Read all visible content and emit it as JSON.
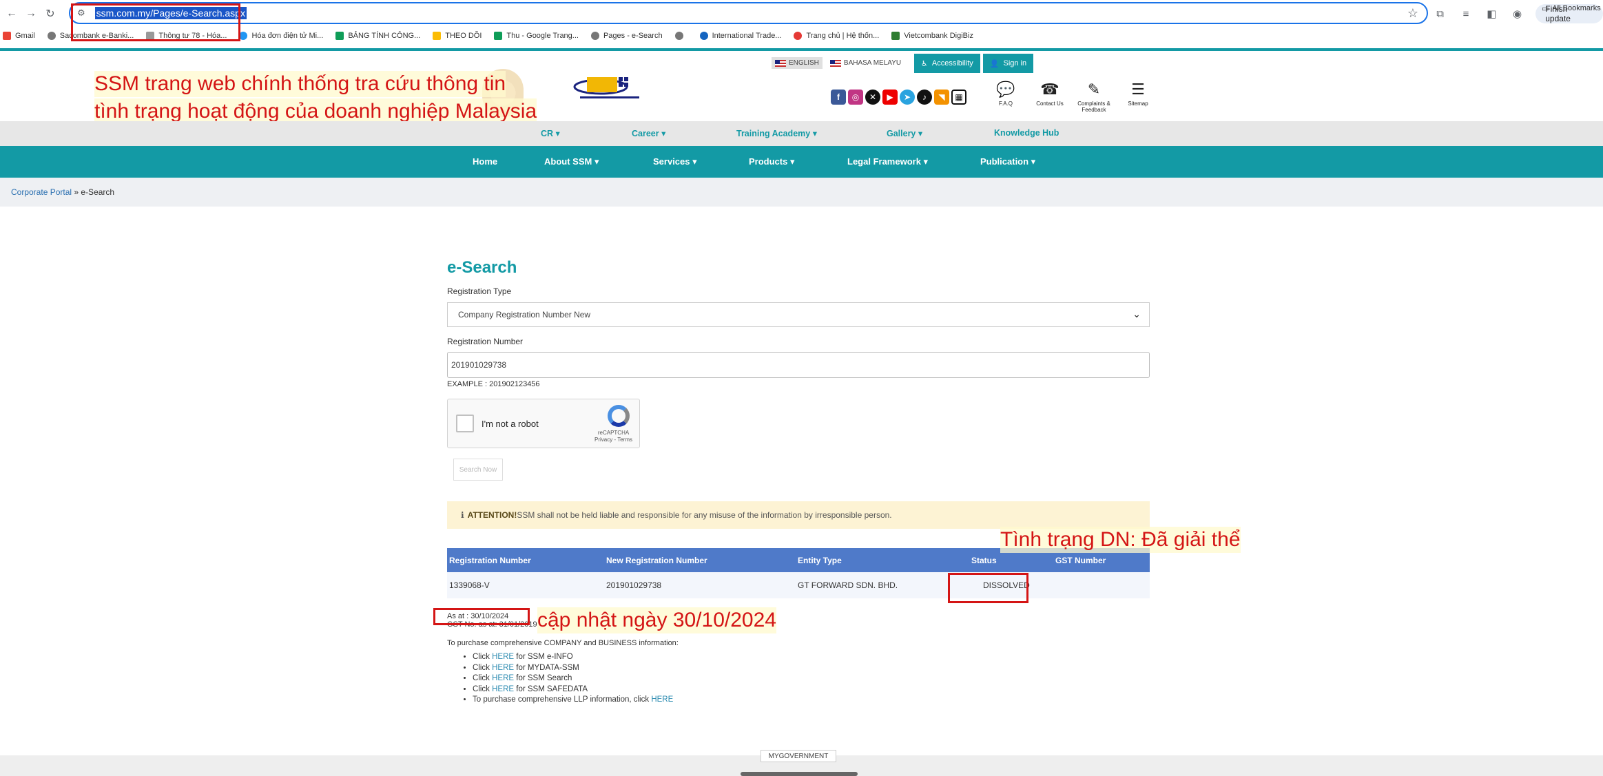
{
  "browser": {
    "url": "ssm.com.my/Pages/e-Search.aspx",
    "finish_update": "Finish update",
    "bookmarks": [
      "Gmail",
      "Sacombank e-Banki...",
      "Thông tư 78 - Hóa...",
      "Hóa đơn điện tử Mi...",
      "BẢNG TÍNH CÔNG...",
      "THEO DÕI",
      "Thu - Google Trang...",
      "Pages - e-Search",
      "",
      "International Trade...",
      "Trang chủ | Hệ thốn...",
      "Vietcombank DigiBiz"
    ],
    "all_bookmarks": "All Bookmarks"
  },
  "header": {
    "lang_en": "ENGLISH",
    "lang_ms": "BAHASA MELAYU",
    "accessibility": "Accessibility",
    "sign_in": "Sign in",
    "quick_links": [
      "F.A.Q",
      "Contact Us",
      "Complaints & Feedback",
      "Sitemap"
    ]
  },
  "annotations": {
    "title_line1": "SSM trang web chính thống tra cứu thông tin",
    "title_line2": "tình trạng hoạt động của doanh nghiệp Malaysia",
    "status_note": "Tình trạng DN: Đã giải thể",
    "date_note": "cập nhật ngày 30/10/2024"
  },
  "subnav": [
    "CR",
    "Career",
    "Training Academy",
    "Gallery",
    "Knowledge Hub"
  ],
  "mainnav": [
    "Home",
    "About SSM",
    "Services",
    "Products",
    "Legal Framework",
    "Publication"
  ],
  "breadcrumb": {
    "home": "Corporate Portal",
    "current": "e-Search"
  },
  "form": {
    "title": "e-Search",
    "reg_type_label": "Registration Type",
    "reg_type_value": "Company Registration Number New",
    "reg_number_label": "Registration Number",
    "reg_number_value": "201901029738",
    "example": "EXAMPLE : 201902123456",
    "captcha_text": "I'm not a robot",
    "captcha_brand": "reCAPTCHA",
    "captcha_terms": "Privacy - Terms",
    "search_button": "Search Now"
  },
  "attention": {
    "label": "ATTENTION!",
    "text": " SSM shall not be held liable and responsible for any misuse of the information by irresponsible person."
  },
  "results": {
    "headers": [
      "Registration Number",
      "New Registration Number",
      "Entity Type",
      "Status",
      "GST Number"
    ],
    "row": [
      "1339068-V",
      "201901029738",
      "GT FORWARD SDN. BHD.",
      "DISSOLVED",
      ""
    ]
  },
  "as_at": "As at : 30/10/2024",
  "gst_as_at": "GST No. as at: 31/01/2019",
  "purchase_intro": "To purchase comprehensive COMPANY and BUSINESS information:",
  "purchase_links": [
    {
      "pre": "Click ",
      "link": "HERE",
      "post": " for SSM e-INFO"
    },
    {
      "pre": "Click ",
      "link": "HERE",
      "post": " for MYDATA-SSM"
    },
    {
      "pre": "Click ",
      "link": "HERE",
      "post": " for SSM Search"
    },
    {
      "pre": "Click ",
      "link": "HERE",
      "post": " for SSM SAFEDATA"
    },
    {
      "pre": "To purchase comprehensive LLP information, click ",
      "link": "HERE",
      "post": ""
    }
  ],
  "footer": {
    "mygovernment": "MYGOVERNMENT"
  },
  "colors": {
    "teal": "#139aa5",
    "table_header": "#4f7ac9",
    "annotation_red": "#d41515"
  }
}
